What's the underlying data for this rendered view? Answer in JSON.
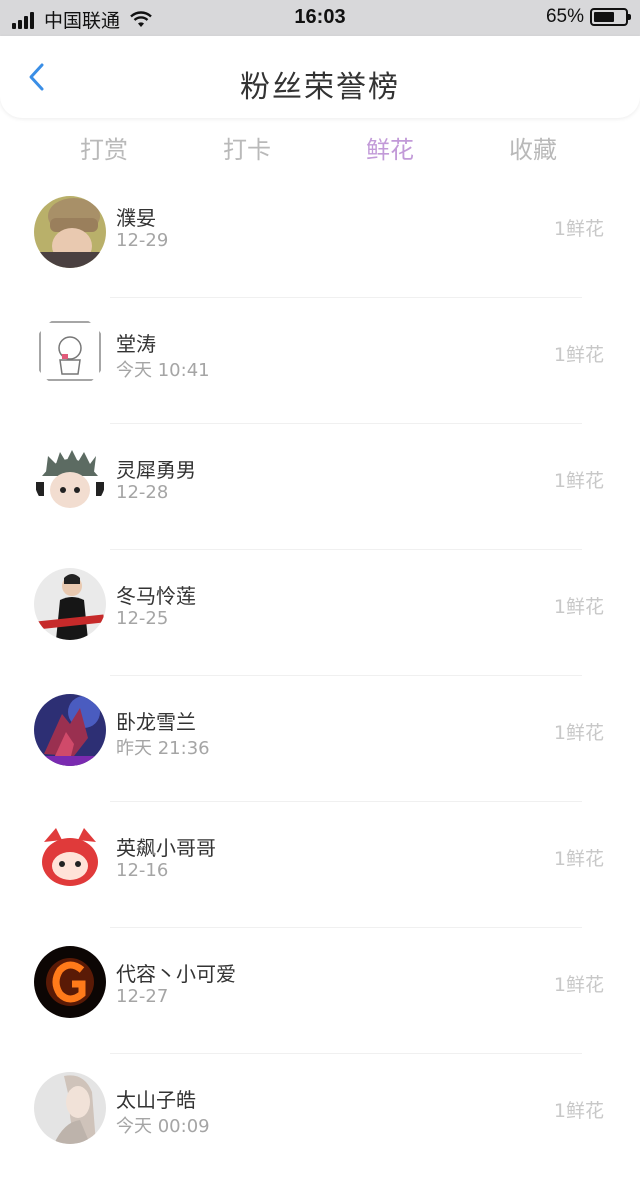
{
  "status_bar": {
    "carrier": "中国联通",
    "time": "16:03",
    "battery": "65%",
    "battery_level": 0.65
  },
  "header": {
    "title": "粉丝荣誉榜",
    "back_icon": "chevron-left-icon"
  },
  "tabs": [
    {
      "label": "打赏",
      "active": false
    },
    {
      "label": "打卡",
      "active": false
    },
    {
      "label": "鲜花",
      "active": true
    },
    {
      "label": "收藏",
      "active": false
    }
  ],
  "colors": {
    "accent": "#c29ad8",
    "back_icon": "#3a8ee6"
  },
  "fans": [
    {
      "name": "濮妟",
      "date": "12-29",
      "amount": "1鲜花"
    },
    {
      "name": "堂涛",
      "date": "今天 10:41",
      "amount": "1鲜花"
    },
    {
      "name": "灵犀勇男",
      "date": "12-28",
      "amount": "1鲜花"
    },
    {
      "name": "冬马怜莲",
      "date": "12-25",
      "amount": "1鲜花"
    },
    {
      "name": "卧龙雪兰",
      "date": "昨天 21:36",
      "amount": "1鲜花"
    },
    {
      "name": "英飙小哥哥",
      "date": "12-16",
      "amount": "1鲜花"
    },
    {
      "name": "代容丶小可爱",
      "date": "12-27",
      "amount": "1鲜花"
    },
    {
      "name": "太山子皓",
      "date": "今天 00:09",
      "amount": "1鲜花"
    }
  ]
}
